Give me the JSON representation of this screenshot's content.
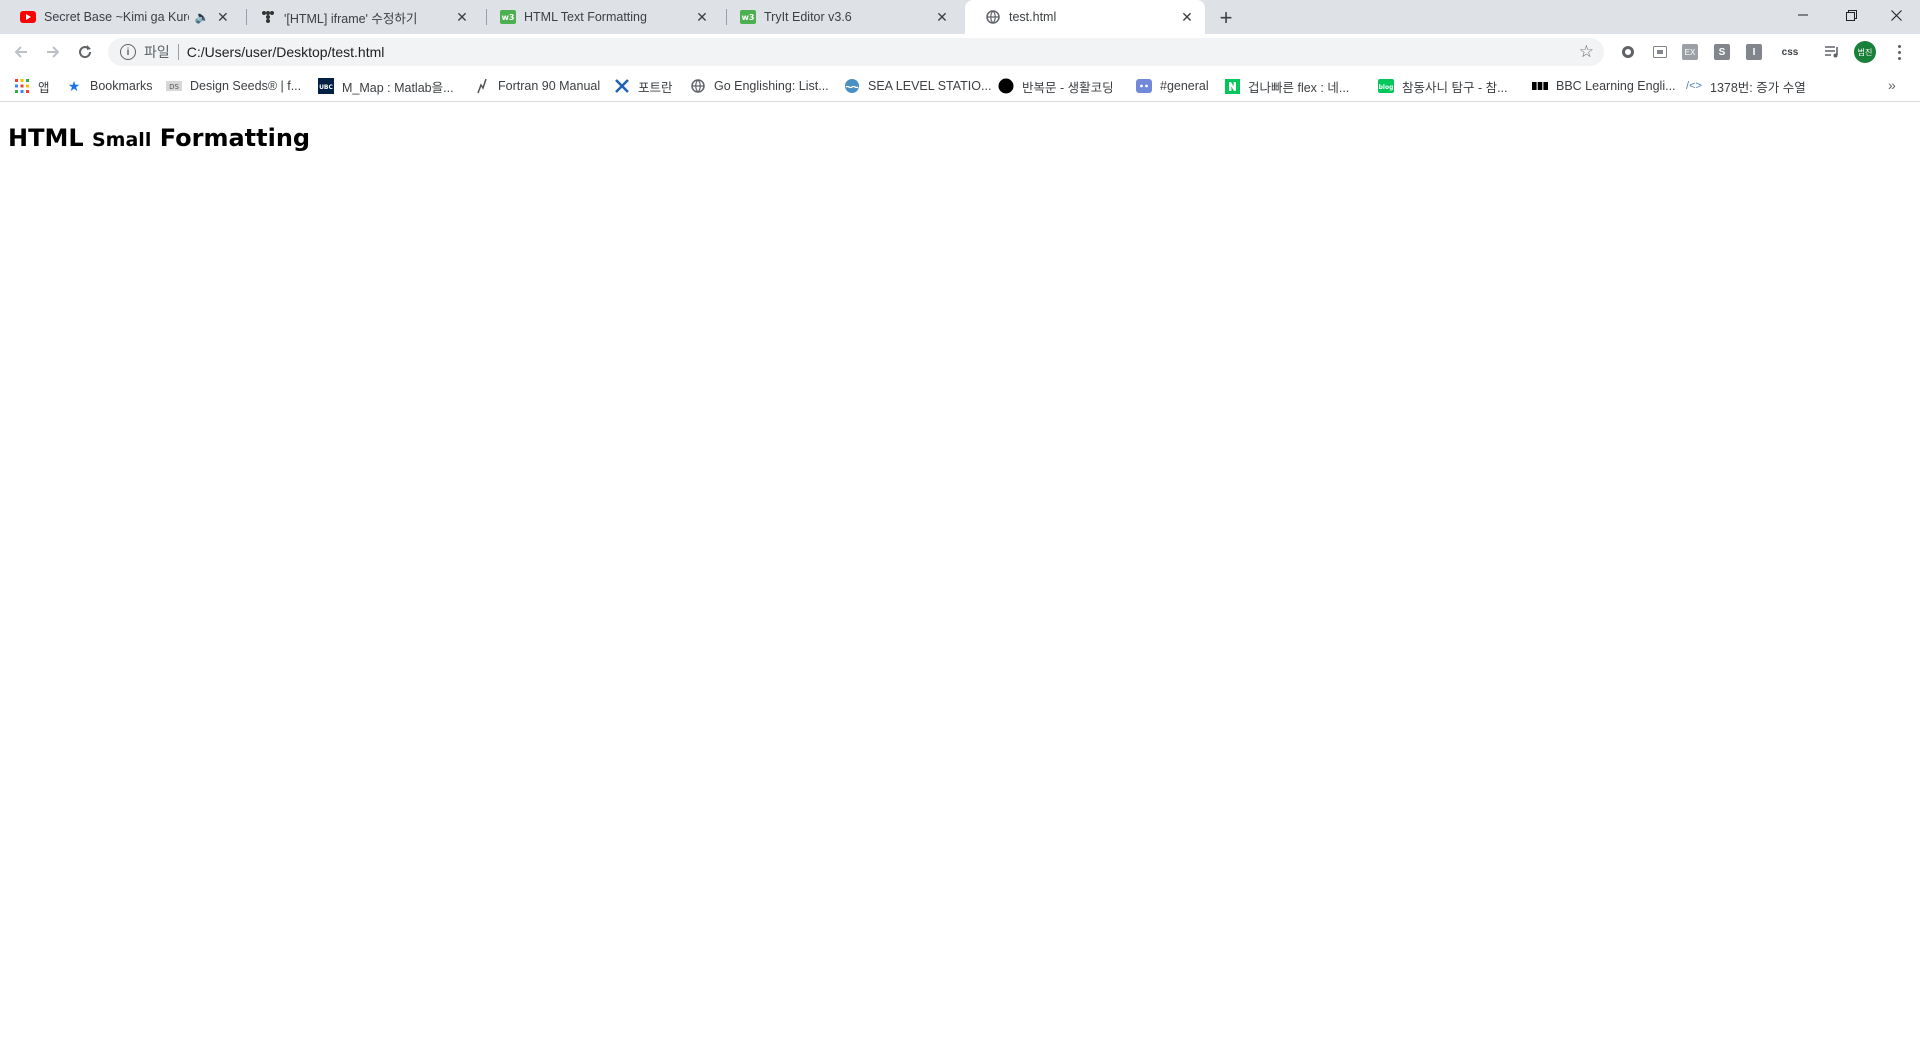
{
  "tabs": [
    {
      "title": "Secret Base ~Kimi ga Kureta",
      "icon": "youtube-icon",
      "audio": true
    },
    {
      "title": "'[HTML] iframe' 수정하기",
      "icon": "tistory-icon"
    },
    {
      "title": "HTML Text Formatting",
      "icon": "w3schools-icon"
    },
    {
      "title": "TryIt Editor v3.6",
      "icon": "w3schools-icon"
    },
    {
      "title": "test.html",
      "icon": "globe-icon",
      "active": true
    }
  ],
  "toolbar": {
    "scheme_label": "파일",
    "url": "C:/Users/user/Desktop/test.html",
    "extension_css": "css",
    "extension_s": "S",
    "extension_i": "I",
    "profile_initials": "범진"
  },
  "bookmarks": [
    {
      "label": "앱",
      "icon": "apps-grid-icon"
    },
    {
      "label": "Bookmarks",
      "icon": "star-icon"
    },
    {
      "label": "Design Seeds® | f...",
      "icon": "design-seeds-icon"
    },
    {
      "label": "M_Map : Matlab을...",
      "icon": "ubc-icon"
    },
    {
      "label": "Fortran 90 Manual",
      "icon": "fortran-icon"
    },
    {
      "label": "포트란",
      "icon": "cross-icon"
    },
    {
      "label": "Go Englishing: List...",
      "icon": "globe-icon"
    },
    {
      "label": "SEA LEVEL STATIO...",
      "icon": "sea-level-icon"
    },
    {
      "label": "반복문 - 생활코딩",
      "icon": "circle-icon"
    },
    {
      "label": "#general",
      "icon": "discord-icon"
    },
    {
      "label": "겁나빠른 flex : 네...",
      "icon": "naver-icon"
    },
    {
      "label": "참동사니 탐구 - 참...",
      "icon": "blog-icon"
    },
    {
      "label": "BBC Learning Engli...",
      "icon": "bbc-icon"
    },
    {
      "label": "1378번: 증가 수열",
      "icon": "code-icon"
    }
  ],
  "page": {
    "heading_part1": "HTML",
    "heading_small": "Small",
    "heading_part2": "Formatting"
  },
  "colors": {
    "tabstrip_bg": "#dee1e6",
    "active_tab_bg": "#ffffff",
    "omnibox_bg": "#f1f3f4",
    "profile_bg": "#188038"
  }
}
